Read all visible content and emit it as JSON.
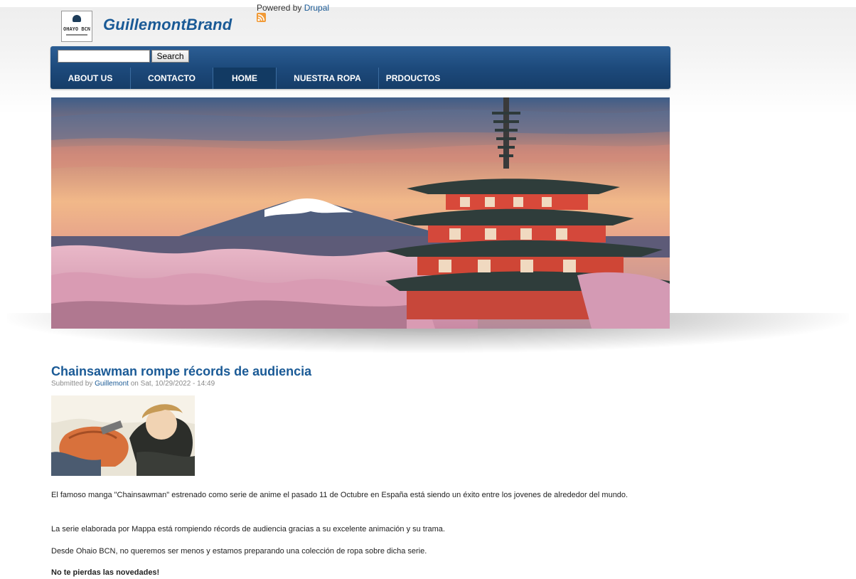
{
  "header": {
    "powered_by_prefix": "Powered by",
    "powered_by_link": "Drupal",
    "site_name": "GuillemontBrand",
    "logo_text": "OHAYO BCN"
  },
  "search": {
    "value": "",
    "placeholder": "",
    "button_label": "Search"
  },
  "nav": {
    "items": [
      {
        "label": "ABOUT US"
      },
      {
        "label": "CONTACTO"
      },
      {
        "label": "HOME",
        "active": true
      },
      {
        "label": "NUESTRA ROPA"
      },
      {
        "label": "PRDOUCTOS"
      }
    ]
  },
  "article": {
    "title": "Chainsawman rompe récords de audiencia",
    "submitted_prefix": "Submitted by",
    "author": "Guillemont",
    "date_text": "on Sat, 10/29/2022 - 14:49",
    "paragraphs": [
      "El famoso manga \"Chainsawman\" estrenado como serie de anime el pasado 11 de Octubre en España está siendo un éxito entre los jovenes de alrededor del mundo.",
      "La serie elaborada por Mappa está rompiendo récords de audiencia gracias a su excelente animación y su trama.",
      " Desde Ohaio BCN, no queremos ser menos y estamos preparando una colección de ropa sobre dicha serie.",
      "No te pierdas las novedades!"
    ]
  },
  "colors": {
    "brand_blue": "#1a5a96",
    "nav_dark": "#163d68",
    "nav_active": "#123a63"
  }
}
